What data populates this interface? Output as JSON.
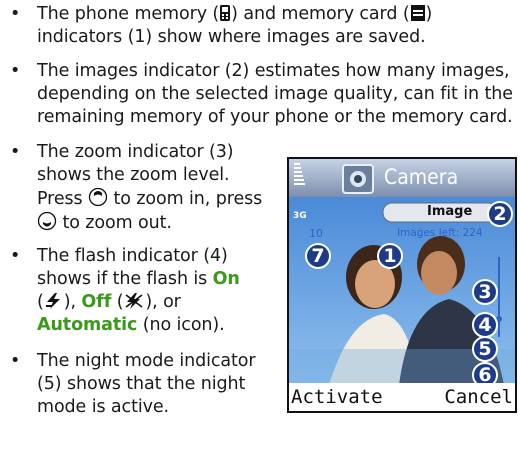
{
  "bullets": {
    "b1_line1_a": "The phone memory (",
    "b1_line1_b": ") and memory card (",
    "b1_line1_c": ")",
    "b1_line2": "indicators (1) show where images are saved.",
    "b2_line1": "The images indicator (2) estimates how many images,",
    "b2_line2": "depending on the selected image quality, can fit in the",
    "b2_line3": "remaining memory of your phone or the memory card.",
    "b3_line1": "The zoom indicator (3)",
    "b3_line2": "shows the zoom level.",
    "b3_line3_a": "Press",
    "b3_line3_b": "to zoom in, press",
    "b3_line4": "to zoom out.",
    "b4_line1": "The flash indicator (4)",
    "b4_line2_a": "shows if the flash is",
    "b4_on": "On",
    "b4_line3_a": "(",
    "b4_line3_b": "),",
    "b4_off": "Off",
    "b4_line3_c": "(",
    "b4_line3_d": "), or",
    "b4_auto": "Automatic",
    "b4_line4_b": "(no icon).",
    "b5_line1": "The night mode indicator",
    "b5_line2": "(5) shows that the night",
    "b5_line3": "mode is active."
  },
  "phone": {
    "title": "Camera",
    "mode": "Image",
    "network": "3G",
    "self_timer": "10",
    "images_left": "Images left: 224",
    "left_softkey": "Activate",
    "right_softkey": "Cancel",
    "callouts": [
      "1",
      "2",
      "3",
      "4",
      "5",
      "6",
      "7"
    ]
  },
  "colors": {
    "accent_green": "#3a9a1c",
    "callout_blue": "#1d3b86",
    "overlay_blue": "#2d63c8"
  },
  "icons": [
    "phone-memory-icon",
    "memory-card-icon",
    "scroll-up-key-icon",
    "scroll-down-key-icon",
    "flash-on-icon",
    "flash-off-icon"
  ]
}
